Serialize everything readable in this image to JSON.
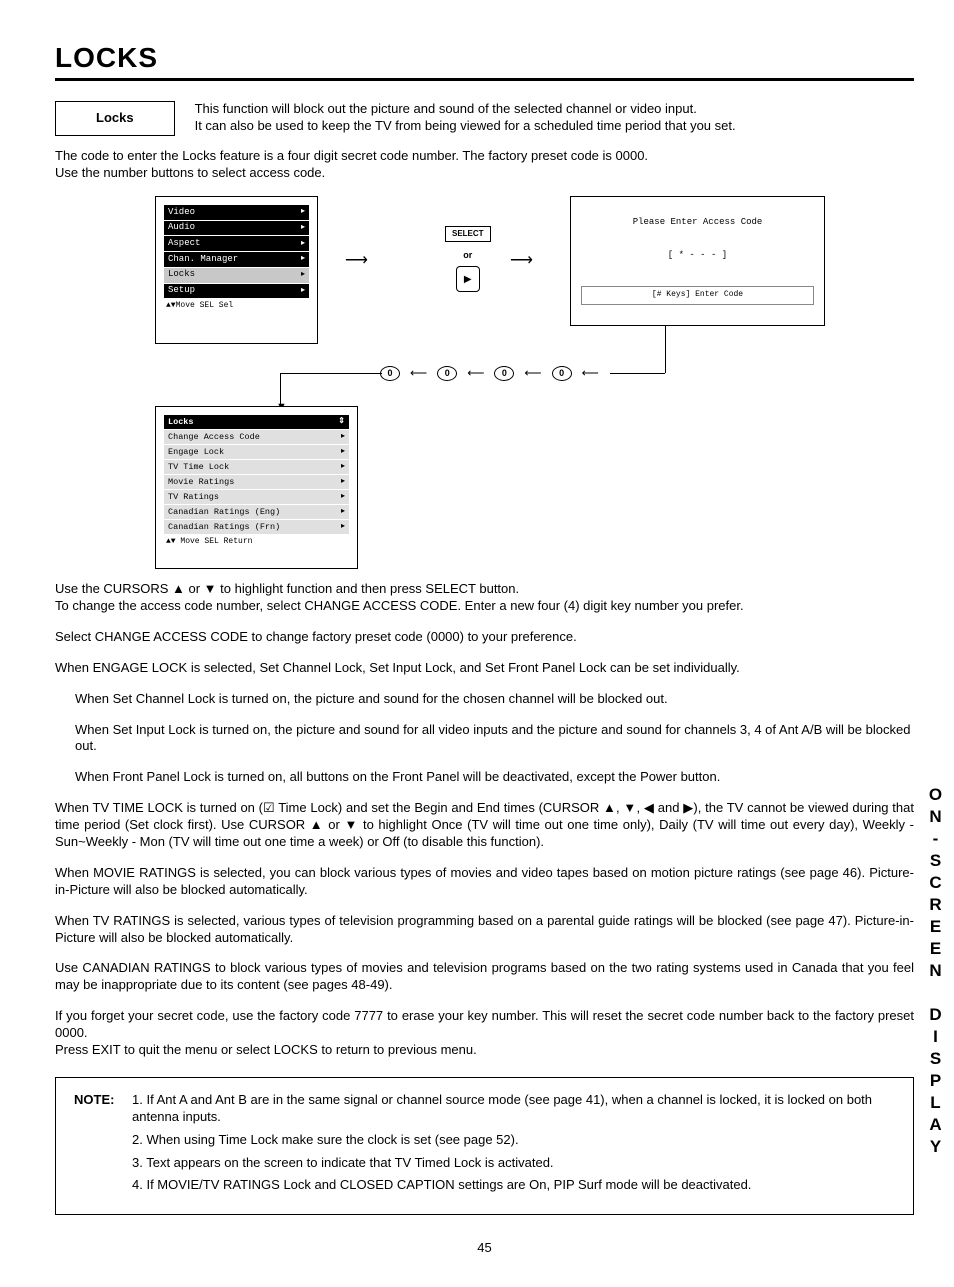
{
  "title": "LOCKS",
  "sideTab": "ON-SCREEN DISPLAY",
  "pageNumber": "45",
  "locksBoxLabel": "Locks",
  "introLine1": "This function will block out the picture and sound of the selected channel or video input.",
  "introLine2": "It can also be used to keep the TV from being viewed for a scheduled time period that you set.",
  "codePara1": "The code to enter the Locks feature is a four digit secret code number.  The factory preset code is 0000.",
  "codePara2": "Use the number buttons to select access code.",
  "menu1": {
    "items": [
      "Video",
      "Audio",
      "Aspect",
      "Chan. Manager",
      "Locks",
      "Setup"
    ],
    "footer": "▲▼Move  SEL  Sel"
  },
  "mid": {
    "select": "SELECT",
    "or": "or"
  },
  "accessBox": {
    "line1": "Please Enter Access Code",
    "line2": "[ * - - - ]",
    "line3": "[# Keys] Enter Code"
  },
  "digits": [
    "0",
    "0",
    "0",
    "0"
  ],
  "menu2": {
    "header": "Locks",
    "items": [
      "Change Access Code",
      "Engage Lock",
      "TV Time Lock",
      "Movie Ratings",
      "TV Ratings",
      "Canadian Ratings (Eng)",
      "Canadian Ratings (Frn)"
    ],
    "footer": "▲▼ Move  SEL  Return"
  },
  "body": {
    "p1a": "Use the CURSORS ▲ or ▼ to highlight function and then press SELECT button.",
    "p1b": "To change the access code number, select CHANGE ACCESS CODE.  Enter a new four (4) digit key number you prefer.",
    "p2": "Select CHANGE ACCESS CODE to change factory preset code (0000) to your preference.",
    "p3": "When ENGAGE LOCK is selected, Set Channel Lock, Set Input Lock, and Set Front Panel Lock can be set individually.",
    "p4": "When Set Channel Lock is turned on, the picture and sound for the chosen channel will be blocked out.",
    "p5": "When Set Input Lock is turned on, the picture and sound for all video inputs and the picture and sound for channels 3, 4 of Ant A/B will be blocked out.",
    "p6": "When Front Panel Lock is turned on, all buttons on the Front Panel will be deactivated, except the Power button.",
    "p7": "When TV TIME LOCK is turned on (☑ Time Lock) and set the Begin and End times (CURSOR ▲, ▼, ◀ and ▶), the TV cannot be viewed during that time period (Set clock first). Use CURSOR ▲ or ▼ to highlight Once (TV will time out one time only), Daily (TV will time out every day), Weekly - Sun~Weekly - Mon (TV will time out one time a week) or Off (to disable this function).",
    "p8": "When MOVIE RATINGS is selected, you can block various types of movies and video tapes based on motion picture ratings (see page 46).  Picture-in-Picture will also be blocked automatically.",
    "p9": "When TV RATINGS is selected, various types of television programming based on a parental guide ratings will be blocked (see page 47).  Picture-in-Picture will also be blocked automatically.",
    "p10": "Use CANADIAN RATINGS to block various types of movies and television programs based on the two rating systems used in Canada that you feel may be inappropriate due to its content (see pages 48-49).",
    "p11": "If you forget your secret code, use the factory code 7777 to erase your key number. This will reset the secret code number back to the factory preset 0000.",
    "p12": "Press EXIT to quit the menu or select LOCKS to return to previous menu."
  },
  "note": {
    "label": "NOTE:",
    "items": [
      "1. If Ant A and Ant B are in the same signal or channel source mode (see page 41), when a channel is locked, it is locked on both antenna inputs.",
      "2. When using Time Lock make sure the clock is set (see page 52).",
      "3. Text appears on the screen to indicate that TV Timed Lock is activated.",
      "4. If MOVIE/TV RATINGS Lock and CLOSED CAPTION settings are On, PIP Surf mode will be deactivated."
    ]
  }
}
